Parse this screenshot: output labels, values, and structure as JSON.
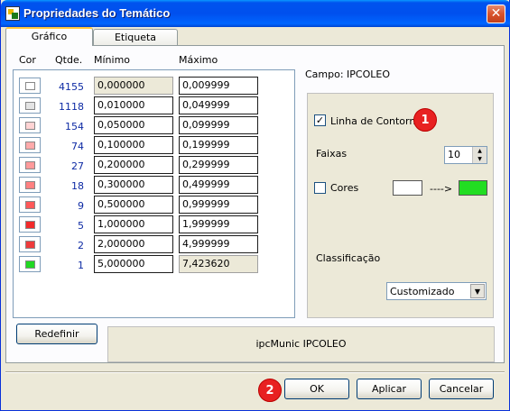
{
  "window": {
    "title": "Propriedades do Temático",
    "close_glyph": "✕"
  },
  "tabs": [
    {
      "label": "Gráfico"
    },
    {
      "label": "Etiqueta"
    }
  ],
  "table": {
    "headers": {
      "color": "Cor",
      "count": "Qtde.",
      "min": "Mínimo",
      "max": "Máximo"
    },
    "rows": [
      {
        "color": "#ffffff",
        "count": "4155",
        "min": "0,000000",
        "max": "0,009999"
      },
      {
        "color": "#e4e4e4",
        "count": "1118",
        "min": "0,010000",
        "max": "0,049999"
      },
      {
        "color": "#ffd3d3",
        "count": "154",
        "min": "0,050000",
        "max": "0,099999"
      },
      {
        "color": "#ffaaaa",
        "count": "74",
        "min": "0,100000",
        "max": "0,199999"
      },
      {
        "color": "#ff9a9a",
        "count": "27",
        "min": "0,200000",
        "max": "0,299999"
      },
      {
        "color": "#ff8080",
        "count": "18",
        "min": "0,300000",
        "max": "0,499999"
      },
      {
        "color": "#ff5858",
        "count": "9",
        "min": "0,500000",
        "max": "0,999999"
      },
      {
        "color": "#f22a2a",
        "count": "5",
        "min": "1,000000",
        "max": "1,999999"
      },
      {
        "color": "#ee3b3b",
        "count": "2",
        "min": "2,000000",
        "max": "4,999999"
      },
      {
        "color": "#22d822",
        "count": "1",
        "min": "5,000000",
        "max": "7,423620"
      }
    ]
  },
  "settings": {
    "campo_label": "Campo: IPCOLEO",
    "contour": {
      "label": "Linha de Contorno",
      "checked": "✓"
    },
    "faixas": {
      "label": "Faixas",
      "value": "10"
    },
    "cores": {
      "label": "Cores",
      "arrow": "---->",
      "from_color": "#ffffff",
      "to_color": "#22dd22"
    },
    "classificacao": {
      "label": "Classificação",
      "selected": "Customizado"
    }
  },
  "info_text": "ipcMunic IPCOLEO",
  "buttons": {
    "redefinir": "Redefinir",
    "ok": "OK",
    "apply": "Aplicar",
    "cancel": "Cancelar"
  },
  "badges": {
    "one": "1",
    "two": "2"
  }
}
